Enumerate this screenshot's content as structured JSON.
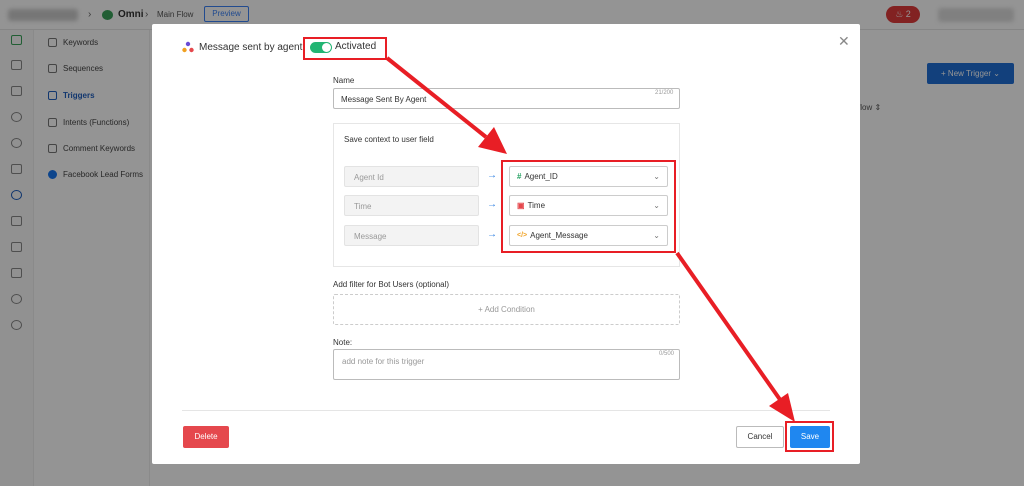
{
  "topbar": {
    "crumb_omni": "Omni",
    "crumb_main_flow": "Main Flow",
    "preview_label": "Preview",
    "notification_count": "2"
  },
  "sidebar": {
    "items": [
      {
        "label": "Keywords"
      },
      {
        "label": "Sequences"
      },
      {
        "label": "Triggers"
      },
      {
        "label": "Intents (Functions)"
      },
      {
        "label": "Comment Keywords"
      },
      {
        "label": "Facebook Lead Forms"
      }
    ]
  },
  "main": {
    "new_trigger_label": "New Trigger",
    "column_flow_label": "flow"
  },
  "modal": {
    "title": "Message sent by agent",
    "status_label": "Activated",
    "toggle_on": true,
    "name_label": "Name",
    "name_value": "Message Sent By Agent",
    "name_counter": "21/200",
    "context_title": "Save context to user field",
    "context_rows": [
      {
        "source": "Agent Id",
        "target": "Agent_ID",
        "target_icon": "hash-icon",
        "icon_glyph": "#"
      },
      {
        "source": "Time",
        "target": "Time",
        "target_icon": "calendar-icon",
        "icon_glyph": "▣"
      },
      {
        "source": "Message",
        "target": "Agent_Message",
        "target_icon": "code-icon",
        "icon_glyph": "</>"
      }
    ],
    "filter_label": "Add filter for Bot Users (optional)",
    "add_condition_label": "+ Add Condition",
    "note_label": "Note:",
    "note_placeholder": "add note for this trigger",
    "note_counter": "0/500",
    "delete_label": "Delete",
    "cancel_label": "Cancel",
    "save_label": "Save"
  },
  "colors": {
    "accent": "#1f87f0",
    "toggle_on": "#22b573",
    "danger": "#e5484d",
    "annotation": "#e81e25"
  }
}
